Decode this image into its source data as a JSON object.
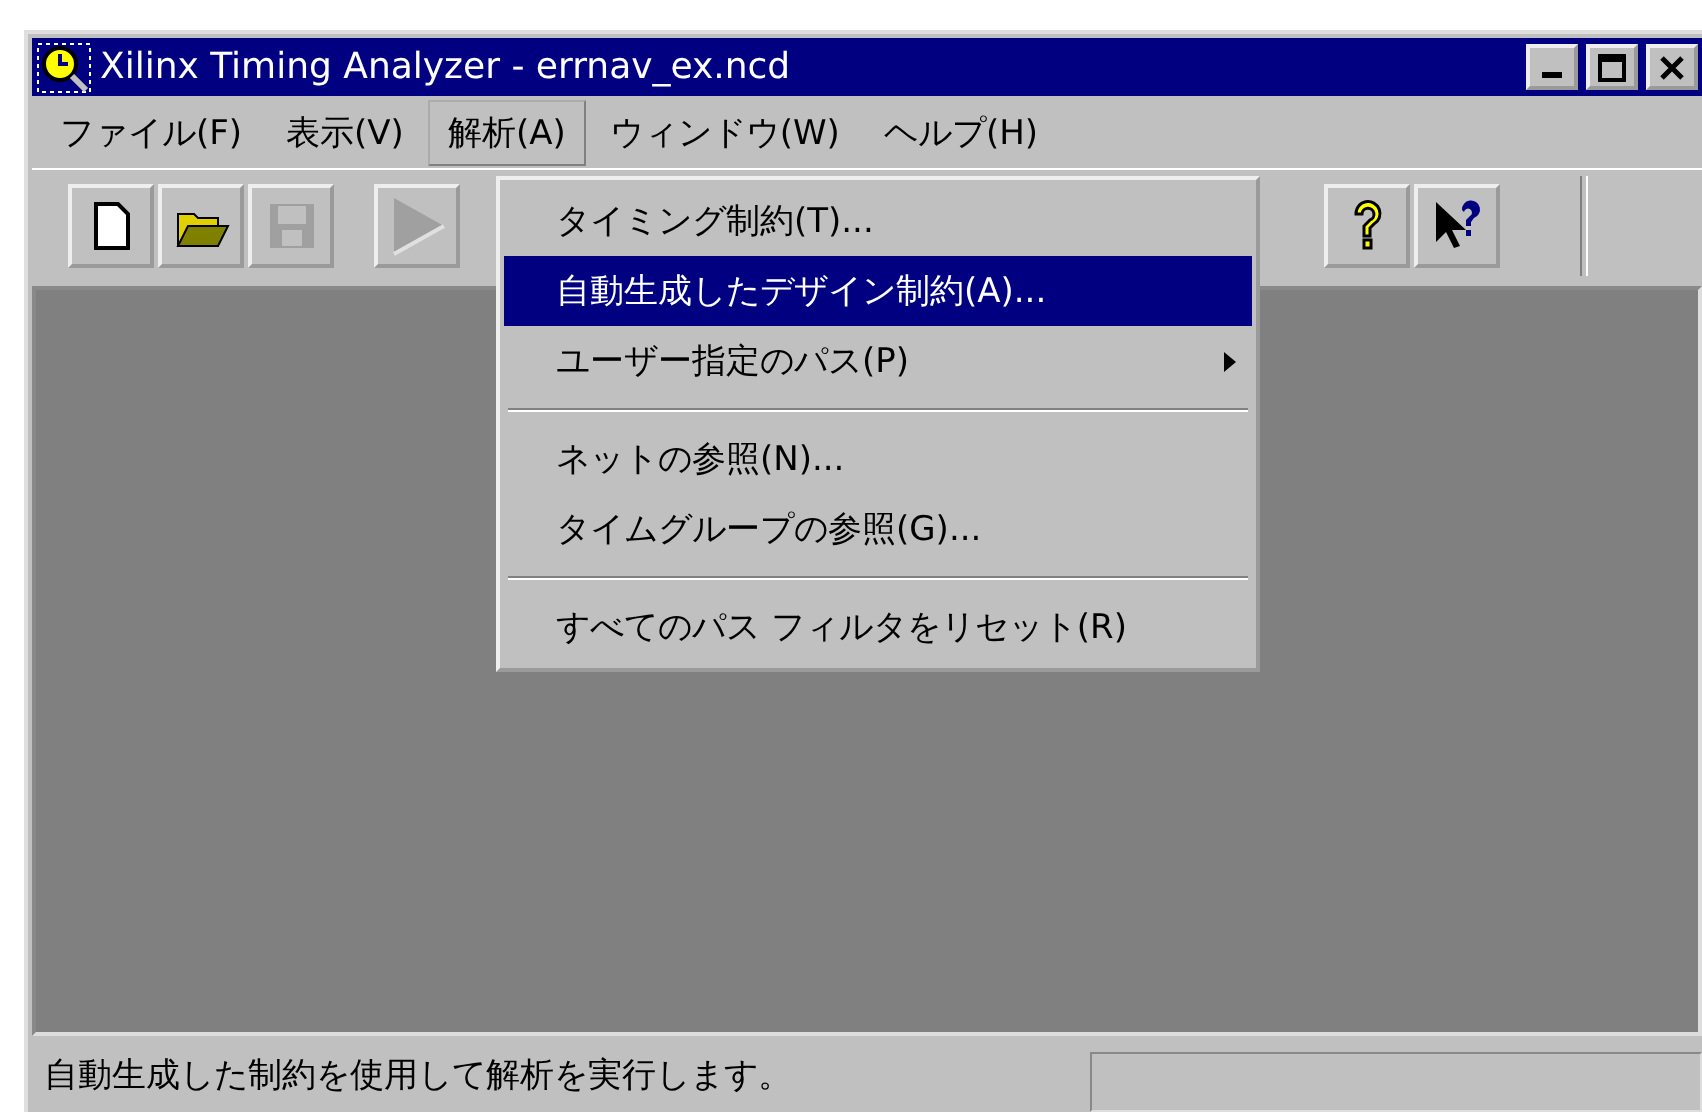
{
  "window": {
    "title": "Xilinx Timing Analyzer - errnav_ex.ncd"
  },
  "menu_bar": [
    {
      "label": "ファイル(F)",
      "selected": false
    },
    {
      "label": "表示(V)",
      "selected": false
    },
    {
      "label": "解析(A)",
      "selected": true
    },
    {
      "label": "ウィンドウ(W)",
      "selected": false
    },
    {
      "label": "ヘルプ(H)",
      "selected": false
    }
  ],
  "toolbar": [
    [
      {
        "kind": "new",
        "disabled": false
      },
      {
        "kind": "open",
        "disabled": false
      },
      {
        "kind": "save",
        "disabled": true
      }
    ],
    [
      {
        "kind": "run",
        "disabled": true
      }
    ],
    [
      {
        "kind": "help",
        "disabled": false
      },
      {
        "kind": "context_help",
        "disabled": false
      }
    ]
  ],
  "dropdown": [
    {
      "kind": "item",
      "label": "タイミング制約(T)...",
      "selected": false,
      "submenu": false
    },
    {
      "kind": "item",
      "label": "自動生成したデザイン制約(A)...",
      "selected": true,
      "submenu": false
    },
    {
      "kind": "item",
      "label": "ユーザー指定のパス(P)",
      "selected": false,
      "submenu": true
    },
    {
      "kind": "separator"
    },
    {
      "kind": "item",
      "label": "ネットの参照(N)...",
      "selected": false,
      "submenu": false
    },
    {
      "kind": "item",
      "label": "タイムグループの参照(G)...",
      "selected": false,
      "submenu": false
    },
    {
      "kind": "separator"
    },
    {
      "kind": "item",
      "label": "すべてのパス フィルタをリセット(R)",
      "selected": false,
      "submenu": false
    }
  ],
  "status_bar": {
    "message": "自動生成した制約を使用して解析を実行します。"
  }
}
